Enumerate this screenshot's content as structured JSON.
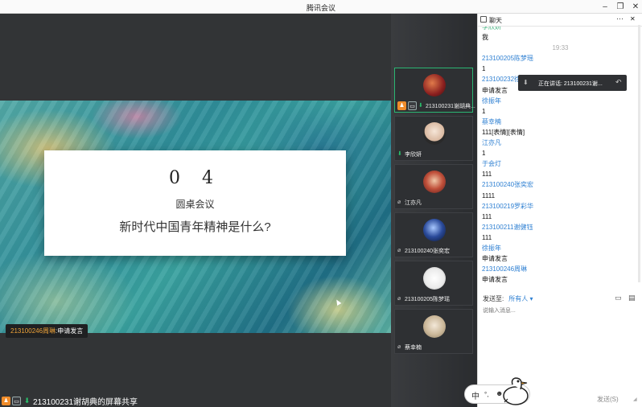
{
  "window": {
    "title": "腾讯会议",
    "min": "–",
    "max": "❐",
    "close": "✕"
  },
  "slide": {
    "number": "0 4",
    "subtitle": "圆桌会议",
    "question": "新时代中国青年精神是什么?"
  },
  "speaking": {
    "name": "213100246周琳",
    "suffix": ":申请发言"
  },
  "screen_share": {
    "label": "213100231谢胡典的屏幕共享"
  },
  "participants": [
    {
      "name": "213100231谢胡典...",
      "color": "#c0392b"
    },
    {
      "name": "李欣妍",
      "color": "#e8d5c4"
    },
    {
      "name": "江亦凡",
      "color": "#b04a3a"
    },
    {
      "name": "213100240张奕宏",
      "color": "#2a4a8a"
    },
    {
      "name": "213100205陈梦瑶",
      "color": "#f0f0f0"
    },
    {
      "name": "蔡幸楠",
      "color": "#d9c9b0"
    }
  ],
  "chat": {
    "title": "聊天",
    "more": "···",
    "close": "✕",
    "messages": [
      {
        "type": "sender",
        "text": "李欣妍"
      },
      {
        "type": "text",
        "text": "我"
      },
      {
        "type": "time",
        "text": "19:33"
      },
      {
        "type": "sender",
        "text": "213100205陈梦瑶"
      },
      {
        "type": "text",
        "text": "1"
      },
      {
        "type": "sender",
        "text": "213100232徐"
      },
      {
        "type": "text",
        "text": "申请发言"
      },
      {
        "type": "sender",
        "text": "徐振年"
      },
      {
        "type": "text",
        "text": "1"
      },
      {
        "type": "sender",
        "text": "蔡幸楠"
      },
      {
        "type": "text",
        "text": "111[表情][表情]"
      },
      {
        "type": "sender",
        "text": "江亦凡"
      },
      {
        "type": "text",
        "text": "1"
      },
      {
        "type": "sender",
        "text": "于会灯"
      },
      {
        "type": "text",
        "text": "111"
      },
      {
        "type": "sender",
        "text": "213100240张奕宏"
      },
      {
        "type": "text",
        "text": "1111"
      },
      {
        "type": "sender",
        "text": "213100219罗彩华"
      },
      {
        "type": "text",
        "text": "111"
      },
      {
        "type": "sender",
        "text": "213100211谢健钰"
      },
      {
        "type": "text",
        "text": "111"
      },
      {
        "type": "sender",
        "text": "徐振年"
      },
      {
        "type": "text",
        "text": "申请发言"
      },
      {
        "type": "sender",
        "text": "213100246周琳"
      },
      {
        "type": "text",
        "text": "申请发言"
      }
    ],
    "tooltip": "正在讲话: 213100231谢...",
    "send_to_label": "发送至:",
    "send_to_value": "所有人 ▾",
    "input_placeholder": "说输入消息...",
    "send_button": "发送(S)"
  },
  "ime": {
    "lang": "中",
    "punct": "°,",
    "emoji": "☻"
  }
}
